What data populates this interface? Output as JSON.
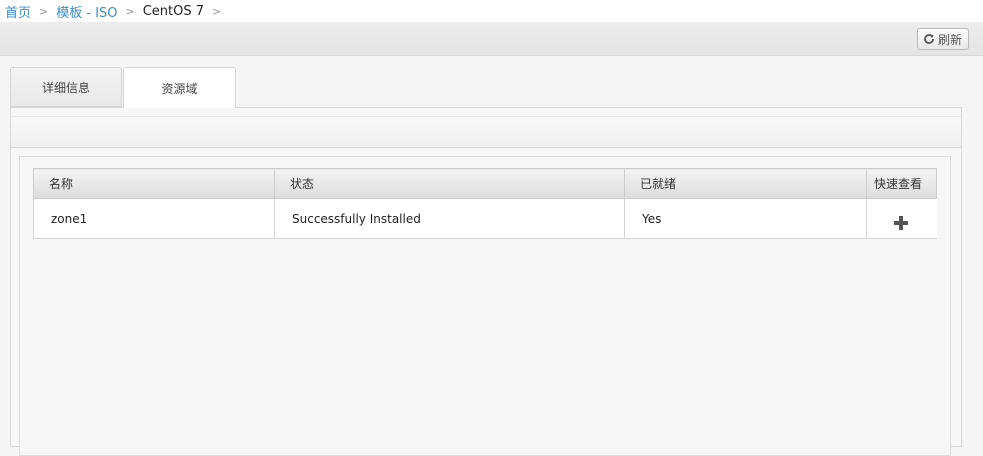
{
  "breadcrumb": {
    "items": [
      {
        "label": "首页"
      },
      {
        "label": "模板 - ISO"
      },
      {
        "label": "CentOS 7"
      }
    ],
    "separator": ">"
  },
  "toolbar": {
    "refresh_label": "刷新",
    "refresh_icon": "refresh-icon"
  },
  "tabs": [
    {
      "label": "详细信息",
      "active": false
    },
    {
      "label": "资源域",
      "active": true
    }
  ],
  "table": {
    "columns": [
      "名称",
      "状态",
      "已就绪",
      "快速查看"
    ],
    "rows": [
      {
        "name": "zone1",
        "status": "Successfully Installed",
        "ready": "Yes",
        "quickview_icon": "plus-icon"
      }
    ]
  },
  "colors": {
    "link": "#3d8cc6",
    "icon": "#555555"
  }
}
